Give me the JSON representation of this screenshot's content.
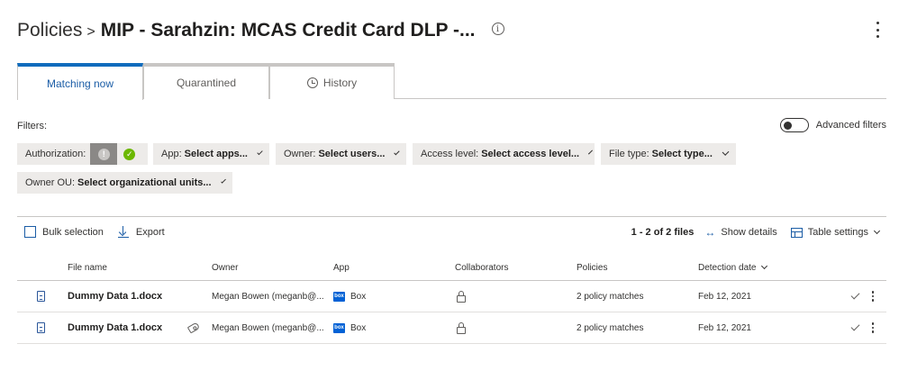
{
  "header": {
    "breadcrumb": "Policies",
    "separator": ">",
    "title": "MIP - Sarahzin: MCAS Credit Card DLP -...",
    "info_icon": "info-icon",
    "more_icon": "more-vertical-icon"
  },
  "tabs": [
    {
      "label": "Matching now",
      "active": true
    },
    {
      "label": "Quarantined",
      "active": false
    },
    {
      "label": "History",
      "active": false,
      "icon": "clock-icon"
    }
  ],
  "filters": {
    "label": "Filters:",
    "advanced_label": "Advanced filters",
    "advanced_enabled": false,
    "authorization_label": "Authorization:",
    "chips": [
      {
        "key": "App:",
        "value": "Select apps..."
      },
      {
        "key": "Owner:",
        "value": "Select users..."
      },
      {
        "key": "Access level:",
        "value": "Select access level..."
      },
      {
        "key": "File type:",
        "value": "Select type..."
      },
      {
        "key": "Owner OU:",
        "value": "Select organizational units..."
      }
    ]
  },
  "toolbar": {
    "bulk_selection": "Bulk selection",
    "export": "Export",
    "count": "1 - 2 of 2 files",
    "show_details": "Show details",
    "table_settings": "Table settings"
  },
  "table": {
    "columns": [
      "File name",
      "Owner",
      "App",
      "Collaborators",
      "Policies",
      "Detection date"
    ],
    "rows": [
      {
        "file_name": "Dummy Data 1.docx",
        "tagged": false,
        "owner": "Megan Bowen (meganb@...",
        "app": "Box",
        "policies": "2 policy matches",
        "date": "Feb 12, 2021"
      },
      {
        "file_name": "Dummy Data 1.docx",
        "tagged": true,
        "owner": "Megan Bowen (meganb@...",
        "app": "Box",
        "policies": "2 policy matches",
        "date": "Feb 12, 2021"
      }
    ]
  },
  "colors": {
    "accent": "#0f6cbd",
    "link": "#1b5da6",
    "box_brand": "#0061d5",
    "success": "#6bb700"
  }
}
